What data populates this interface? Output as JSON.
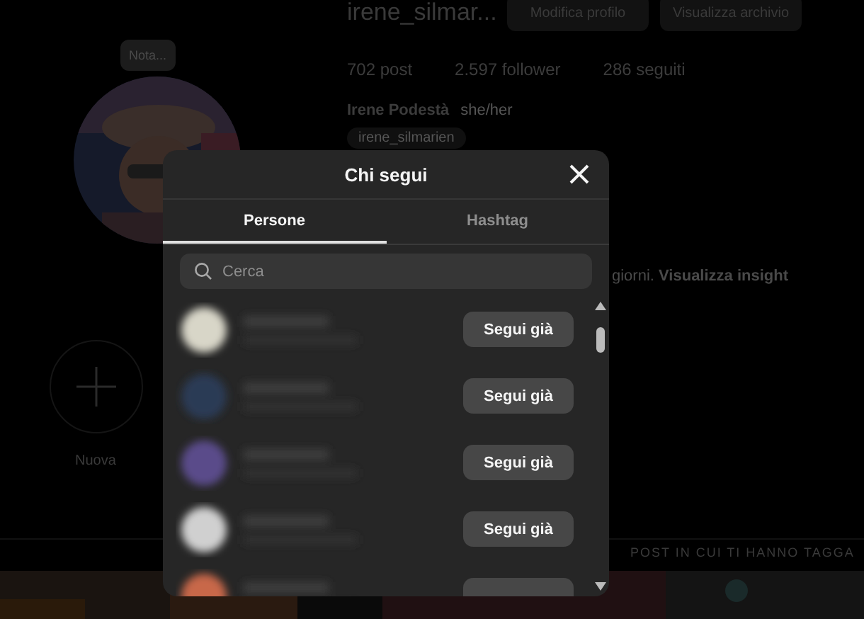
{
  "profile": {
    "note": "Nota...",
    "username": "irene_silmar...",
    "buttons": [
      "Modifica profilo",
      "Visualizza archivio"
    ],
    "stats": [
      "702 post",
      "2.597 follower",
      "286 seguiti"
    ],
    "name": "Irene Podestà",
    "pronouns": "she/her",
    "link": "irene_silmarien",
    "insight": "giorni. **Visualizza insight**",
    "new_highlight": "Nuova",
    "tagged_tab": "POST IN CUI TI HANNO TAGGA"
  },
  "dialog": {
    "title": "Chi segui",
    "tabs": [
      {
        "label": "Persone",
        "selected": true
      },
      {
        "label": "Hashtag",
        "selected": false
      }
    ],
    "search": {
      "placeholder": "Cerca"
    },
    "rows": [
      {
        "kind": "full",
        "button": "Segui già"
      },
      {
        "kind": "full",
        "button": "Segui già"
      },
      {
        "kind": "full",
        "button": "Segui già"
      },
      {
        "kind": "full",
        "button": "Segui già"
      },
      {
        "kind": "partial"
      }
    ]
  }
}
